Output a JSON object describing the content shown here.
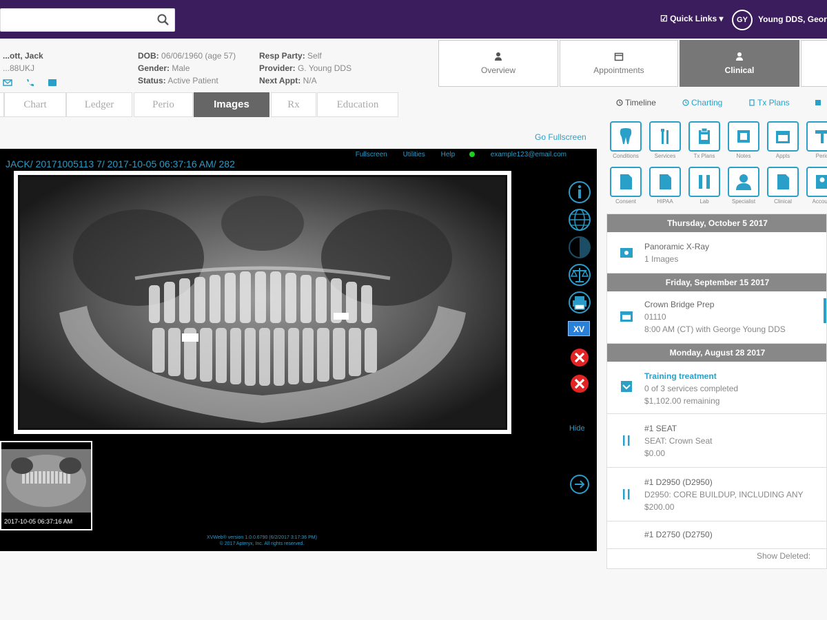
{
  "topbar": {
    "search": {
      "value": "",
      "placeholder": ""
    },
    "quick_links": "☑ Quick Links ▾",
    "avatar_initials": "GY",
    "user_name": "Young DDS, George"
  },
  "patient": {
    "name": "...ott, Jack",
    "id_line": "...88UKJ",
    "dob_label": "DOB:",
    "dob_value": "06/06/1960 (age 57)",
    "gender_label": "Gender:",
    "gender_value": "Male",
    "status_label": "Status:",
    "status_value": "Active Patient",
    "resp_label": "Resp Party:",
    "resp_value": "Self",
    "provider_label": "Provider:",
    "provider_value": "G. Young DDS",
    "next_label": "Next Appt:",
    "next_value": "N/A"
  },
  "main_tabs": [
    {
      "label": "Overview"
    },
    {
      "label": "Appointments"
    },
    {
      "label": "Clinical",
      "active": true
    }
  ],
  "sub_tabs": [
    {
      "label": "Chart"
    },
    {
      "label": "Ledger"
    },
    {
      "label": "Perio"
    },
    {
      "label": "Images",
      "active": true
    },
    {
      "label": "Rx"
    },
    {
      "label": "Education"
    }
  ],
  "go_fullscreen": "Go Fullscreen",
  "viewer": {
    "menu": [
      "Fullscreen",
      "Utilities",
      "Help"
    ],
    "email": "example123@email.com",
    "image_title": "JACK/ 20171005113 7/ 2017-10-05 06:37:16 AM/ 282",
    "hide": "Hide",
    "thumb_label": "2017-10-05 06:37:16 AM",
    "tool_label": "XV",
    "footer_line1": "XVWeb® version 1.0.0.6790 (6/2/2017 3:17:36 PM)",
    "footer_line2": "© 2017 Apteryx, Inc. All rights reserved."
  },
  "right_tabs": [
    {
      "label": "Timeline",
      "active": true
    },
    {
      "label": "Charting"
    },
    {
      "label": "Tx Plans"
    }
  ],
  "quick_icons_row1": [
    "Conditions",
    "Services",
    "Tx Plans",
    "Notes",
    "Appts",
    "Perio"
  ],
  "quick_icons_row2": [
    "Consent",
    "HIPAA",
    "Lab",
    "Specialist",
    "Clinical",
    "Account"
  ],
  "timeline": {
    "groups": [
      {
        "date": "Thursday, October 5 2017"
      },
      {
        "date": "Friday, September 15 2017"
      },
      {
        "date": "Monday, August 28 2017"
      }
    ],
    "items": [
      {
        "l1": "Panoramic X-Ray",
        "l2": "1 Images"
      },
      {
        "l1": "Crown Bridge Prep",
        "l2": "01110",
        "l3": "8:00 AM (CT) with George Young DDS"
      },
      {
        "l1": "Training treatment",
        "l2": "0 of 3 services completed",
        "l3": "$1,102.00 remaining"
      },
      {
        "l1": "#1 SEAT",
        "l2": "SEAT: Crown Seat",
        "l3": "$0.00"
      },
      {
        "l1": "#1 D2950   (D2950)",
        "l2": "D2950: CORE BUILDUP, INCLUDING ANY",
        "l3": "$200.00"
      },
      {
        "l1": "#1 D2750   (D2750)"
      }
    ],
    "show_deleted": "Show Deleted:"
  }
}
